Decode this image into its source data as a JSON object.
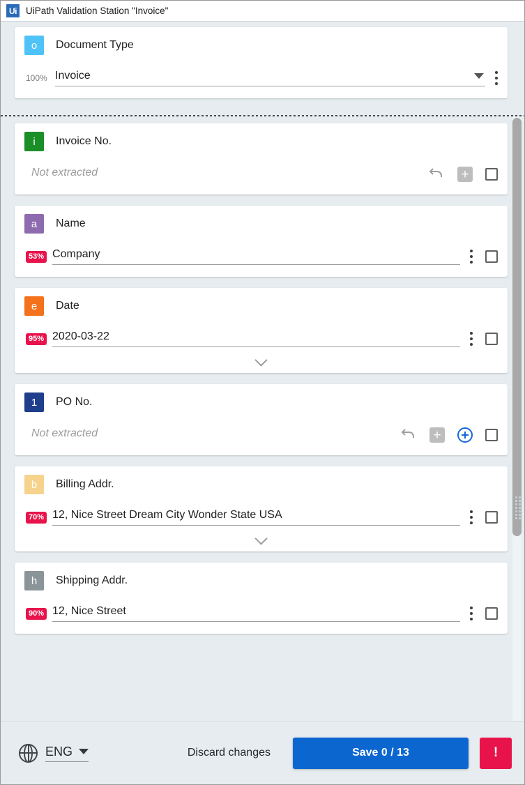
{
  "window": {
    "logo_text": "Ui",
    "title": "UiPath Validation Station \"Invoice\""
  },
  "document_type": {
    "badge_letter": "o",
    "badge_color": "#4FC3F7",
    "label": "Document Type",
    "confidence": "100%",
    "value": "Invoice"
  },
  "fields": [
    {
      "badge_letter": "i",
      "badge_color": "#1A8E27",
      "label": "Invoice No.",
      "confidence": "",
      "value": "Not extracted",
      "extracted": false,
      "has_undo": true,
      "has_plus_box": true,
      "has_circle_plus": false,
      "has_kebab": false,
      "has_expander": false
    },
    {
      "badge_letter": "a",
      "badge_color": "#8E6BAF",
      "label": "Name",
      "confidence": "53%",
      "value": "Company",
      "extracted": true,
      "has_undo": false,
      "has_plus_box": false,
      "has_circle_plus": false,
      "has_kebab": true,
      "has_expander": false
    },
    {
      "badge_letter": "e",
      "badge_color": "#F4721C",
      "label": "Date",
      "confidence": "95%",
      "value": "2020-03-22",
      "extracted": true,
      "has_undo": false,
      "has_plus_box": false,
      "has_circle_plus": false,
      "has_kebab": true,
      "has_expander": true
    },
    {
      "badge_letter": "1",
      "badge_color": "#1F3E8C",
      "label": "PO No.",
      "confidence": "",
      "value": "Not extracted",
      "extracted": false,
      "has_undo": true,
      "has_plus_box": true,
      "has_circle_plus": true,
      "has_kebab": false,
      "has_expander": false
    },
    {
      "badge_letter": "b",
      "badge_color": "#F6D38C",
      "label": "Billing Addr.",
      "confidence": "70%",
      "value": "12, Nice Street Dream City Wonder State USA",
      "extracted": true,
      "has_undo": false,
      "has_plus_box": false,
      "has_circle_plus": false,
      "has_kebab": true,
      "has_expander": true
    },
    {
      "badge_letter": "h",
      "badge_color": "#8A9499",
      "label": "Shipping Addr.",
      "confidence": "90%",
      "value": "12, Nice Street",
      "extracted": true,
      "has_undo": false,
      "has_plus_box": false,
      "has_circle_plus": false,
      "has_kebab": true,
      "has_expander": false
    }
  ],
  "footer": {
    "language": "ENG",
    "discard_label": "Discard changes",
    "save_label": "Save 0 / 13",
    "alert_label": "!",
    "save_color": "#0B66D0",
    "alert_color": "#E8134B"
  }
}
